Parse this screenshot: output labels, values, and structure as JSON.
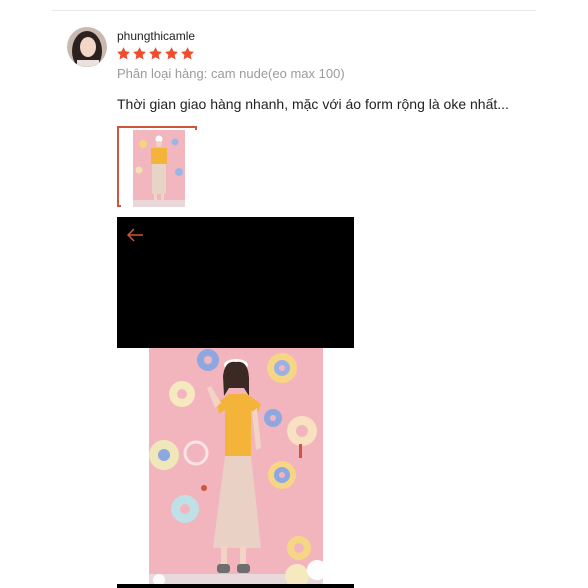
{
  "review": {
    "username": "phungthicamle",
    "rating": 5,
    "rating_max": 5,
    "variation_text": "Phân loại hàng: cam nude(eo max 100)",
    "comment": "Thời gian giao hàng nhanh, mặc với áo form rộng là oke nhất...",
    "star_color": "#ee4d2d",
    "thumbnail_border_color": "#d0553d"
  },
  "viewer": {
    "back_icon": "arrow-left-icon",
    "icon_color": "#d0553d"
  }
}
